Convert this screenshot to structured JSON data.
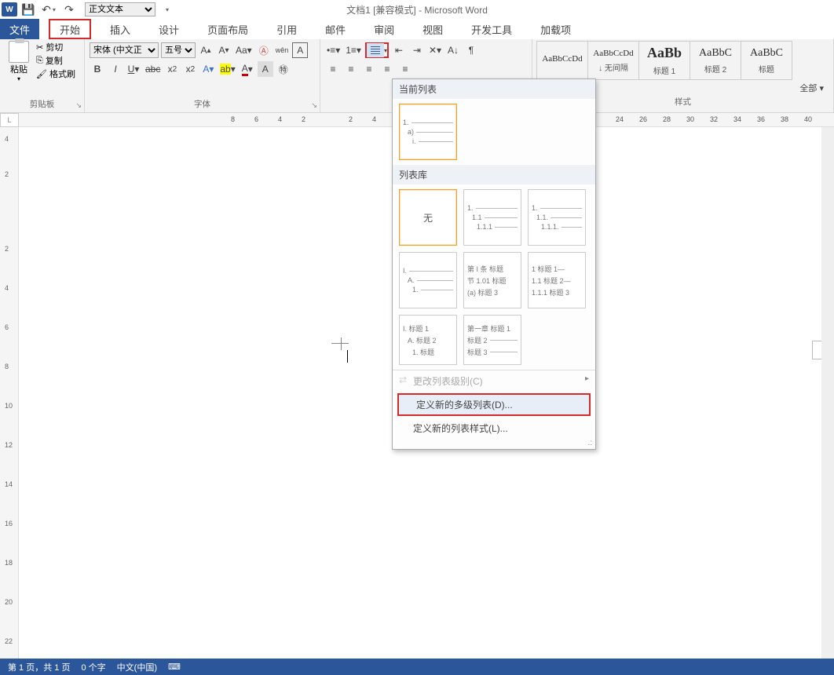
{
  "qat": {
    "save": "",
    "undo": "",
    "style_select": "正文文本"
  },
  "title": "文档1 [兼容模式] - Microsoft Word",
  "tabs": {
    "file": "文件",
    "home": "开始",
    "insert": "插入",
    "design": "设计",
    "layout": "页面布局",
    "refs": "引用",
    "mail": "邮件",
    "review": "审阅",
    "view": "视图",
    "dev": "开发工具",
    "addin": "加载项"
  },
  "clipboard": {
    "paste": "粘贴",
    "cut": "剪切",
    "copy": "复制",
    "fmtpaint": "格式刷",
    "group": "剪贴板"
  },
  "font": {
    "name": "宋体 (中文正",
    "size": "五号",
    "group": "字体"
  },
  "paragraph": {
    "group": ""
  },
  "styles": {
    "group": "样式",
    "all": "全部 ▾",
    "items": [
      {
        "prev": "AaBbCcDd",
        "label": ""
      },
      {
        "prev": "AaBbCcDd",
        "label": "↓ 无间隔"
      },
      {
        "prev": "AaBb",
        "label": "标题 1"
      },
      {
        "prev": "AaBbC",
        "label": "标题 2"
      },
      {
        "prev": "AaBbC",
        "label": "标题"
      }
    ]
  },
  "ruler": {
    "marks": [
      "8",
      "6",
      "4",
      "2",
      "",
      "2",
      "4",
      "",
      "",
      "",
      "",
      "",
      "24",
      "26",
      "28",
      "30",
      "32",
      "34",
      "36",
      "38",
      "40"
    ]
  },
  "vruler": [
    "4",
    "2",
    "",
    "2",
    "4",
    "6",
    "8",
    "10",
    "12",
    "14",
    "16",
    "18",
    "20",
    "22"
  ],
  "dropdown": {
    "current": "当前列表",
    "cur_tile": [
      "1.",
      "a)",
      "i."
    ],
    "library": "列表库",
    "none": "无",
    "lib": [
      [
        "1.",
        "1.1",
        "1.1.1"
      ],
      [
        "1.",
        "1.1.",
        "1.1.1."
      ],
      [
        "I.",
        "A.",
        "1."
      ],
      [
        "第 I 条 标题",
        "节 1.01 标题",
        "(a) 标题 3"
      ],
      [
        "1 标题 1—",
        "1.1 标题 2—",
        "1.1.1 标题 3"
      ],
      [
        "I. 标题 1",
        "A. 标题 2",
        "1. 标题"
      ],
      [
        "第一章 标题 1",
        "标题 2",
        "标题 3"
      ]
    ],
    "change_level": "更改列表级别(C)",
    "define_new": "定义新的多级列表(D)...",
    "define_style": "定义新的列表样式(L)..."
  },
  "status": {
    "page": "第 1 页，共 1 页",
    "words": "0 个字",
    "lang": "中文(中国)",
    "mode": ""
  }
}
